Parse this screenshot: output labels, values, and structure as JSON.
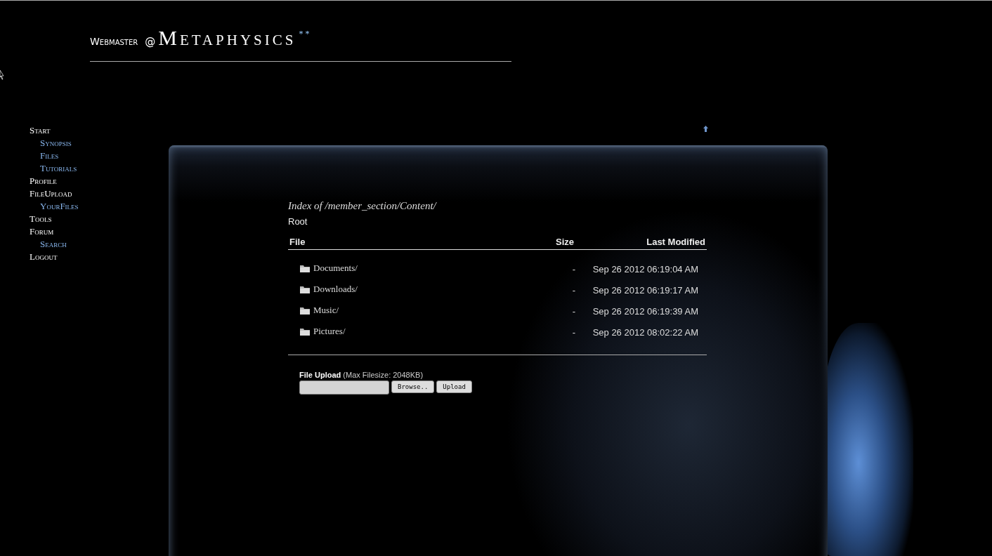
{
  "header": {
    "prefix": "Webmaster",
    "at": "@",
    "name": "Metaphysics",
    "suffix": "**"
  },
  "nav": [
    {
      "label": "Start",
      "children": [
        {
          "label": "Synopsis"
        },
        {
          "label": "Files"
        },
        {
          "label": "Tutorials"
        }
      ]
    },
    {
      "label": "Profile"
    },
    {
      "label": "FileUpload",
      "children": [
        {
          "label": "YourFiles"
        }
      ]
    },
    {
      "label": "Tools"
    },
    {
      "label": "Forum",
      "children": [
        {
          "label": "Search"
        }
      ]
    },
    {
      "label": "Logout"
    }
  ],
  "listing": {
    "title": "Index of /member_section/Content/",
    "breadcrumb": "Root",
    "columns": [
      "File",
      "Size",
      "Last Modified"
    ],
    "rows": [
      {
        "name": "Documents/",
        "size": "-",
        "modified": "Sep 26 2012 06:19:04 AM"
      },
      {
        "name": "Downloads/",
        "size": "-",
        "modified": "Sep 26 2012 06:19:17 AM"
      },
      {
        "name": "Music/",
        "size": "-",
        "modified": "Sep 26 2012 06:19:39 AM"
      },
      {
        "name": "Pictures/",
        "size": "-",
        "modified": "Sep 26 2012 08:02:22 AM"
      }
    ]
  },
  "upload": {
    "label": "File Upload",
    "note": "(Max Filesize: 2048KB)",
    "browse": "Browse..",
    "submit": "Upload"
  }
}
